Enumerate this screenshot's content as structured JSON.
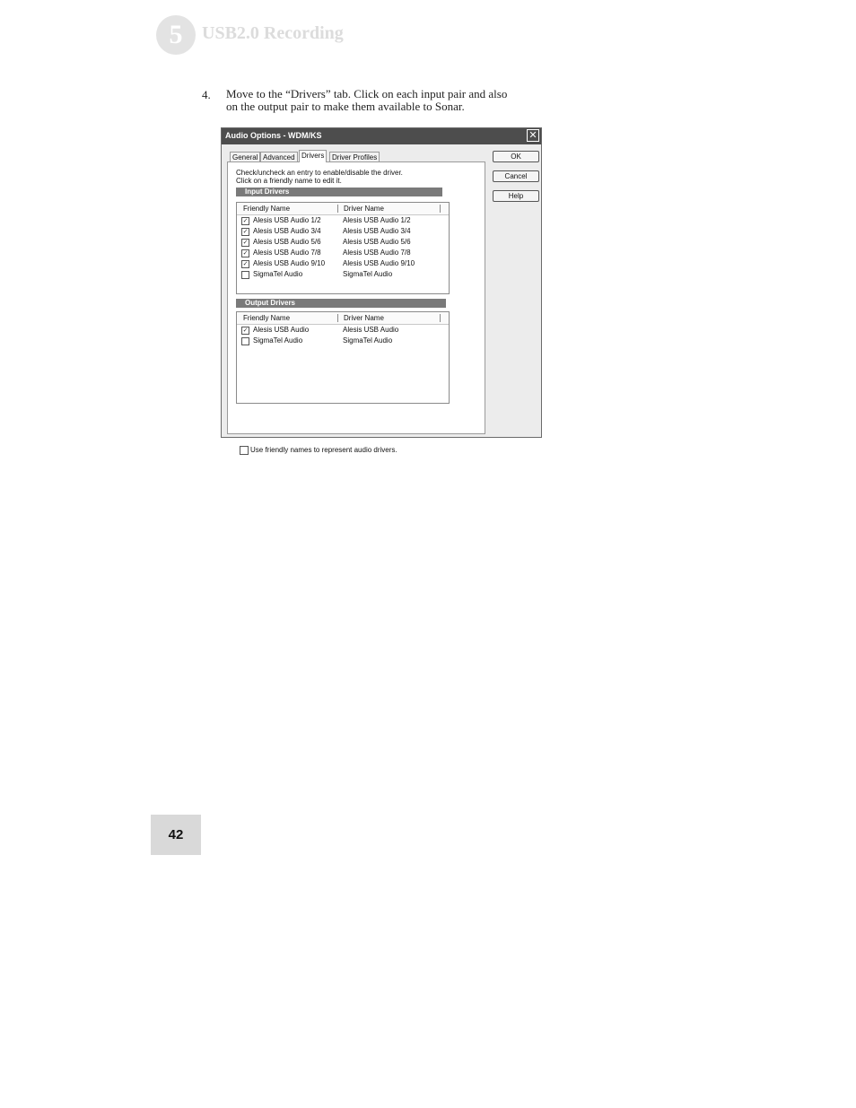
{
  "header": {
    "chapter_number": "5",
    "chapter_title": "USB2.0 Recording"
  },
  "step": {
    "number": "4.",
    "line1": "Move to the “Drivers” tab.  Click on each input pair and also",
    "line2": "on the output pair to make them available to Sonar."
  },
  "dialog": {
    "title": "Audio Options - WDM/KS",
    "close_glyph": "✕",
    "tabs": [
      "General",
      "Advanced",
      "Drivers",
      "Driver Profiles"
    ],
    "buttons": {
      "ok": "OK",
      "cancel": "Cancel",
      "help": "Help"
    },
    "instructions": [
      "Check/uncheck an entry to enable/disable the driver.",
      "Click on a friendly name to edit it."
    ],
    "input_section": {
      "title": "Input Drivers",
      "columns": [
        "Friendly Name",
        "Driver Name"
      ],
      "rows": [
        {
          "friendly": "Alesis USB Audio 1/2",
          "driver": "Alesis USB Audio 1/2",
          "check": "✓"
        },
        {
          "friendly": "Alesis USB Audio 3/4",
          "driver": "Alesis USB Audio 3/4",
          "check": "✓"
        },
        {
          "friendly": "Alesis USB Audio 5/6",
          "driver": "Alesis USB Audio 5/6",
          "check": "✓"
        },
        {
          "friendly": "Alesis USB Audio 7/8",
          "driver": "Alesis USB Audio 7/8",
          "check": "✓"
        },
        {
          "friendly": "Alesis USB Audio 9/10",
          "driver": "Alesis USB Audio 9/10",
          "check": "✓"
        },
        {
          "friendly": "SigmaTel Audio",
          "driver": "SigmaTel Audio",
          "check": ""
        }
      ]
    },
    "output_section": {
      "title": "Output Drivers",
      "columns": [
        "Friendly Name",
        "Driver Name"
      ],
      "rows": [
        {
          "friendly": "Alesis USB Audio",
          "driver": "Alesis USB Audio",
          "check": "✓"
        },
        {
          "friendly": "SigmaTel Audio",
          "driver": "SigmaTel Audio",
          "check": ""
        }
      ]
    },
    "footer_checkbox_label": "Use friendly names to represent audio drivers."
  },
  "page_number": "42"
}
